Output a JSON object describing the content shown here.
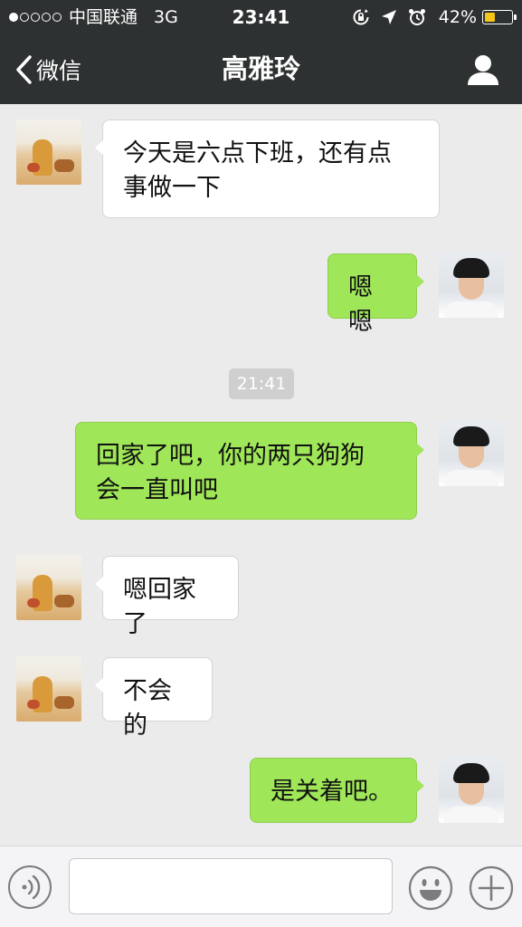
{
  "status_bar": {
    "signal_filled": 1,
    "signal_total": 5,
    "carrier": "中国联通",
    "network": "3G",
    "time": "23:41",
    "battery": "42%",
    "battery_level": 0.42,
    "icons": [
      "rotation-lock-icon",
      "location-arrow-icon",
      "alarm-icon"
    ]
  },
  "nav": {
    "back_label": "微信",
    "title": "高雅玲"
  },
  "messages": [
    {
      "side": "in",
      "lines": [
        "今天是六点下班，还有点",
        "事做一下"
      ],
      "avatar": "contact-avatar"
    },
    {
      "side": "out",
      "lines": [
        "嗯嗯"
      ],
      "avatar": "my-avatar"
    },
    {
      "side": "out",
      "lines": [
        "回家了吧，你的两只狗狗",
        "会一直叫吧"
      ],
      "avatar": "my-avatar"
    },
    {
      "side": "in",
      "lines": [
        "嗯回家了"
      ],
      "avatar": "contact-avatar"
    },
    {
      "side": "in",
      "lines": [
        "不会的"
      ],
      "avatar": "contact-avatar"
    },
    {
      "side": "out",
      "lines": [
        "是关着吧。"
      ],
      "avatar": "my-avatar"
    }
  ],
  "timestamp": "21:41",
  "input_bar": {
    "value": "",
    "icons": [
      "voice-icon",
      "emoji-icon",
      "plus-icon"
    ]
  },
  "colors": {
    "topbar": "#2e3132",
    "background": "#ebebeb",
    "bubble_in": "#ffffff",
    "bubble_out": "#9fe658",
    "battery": "#f5c518"
  }
}
